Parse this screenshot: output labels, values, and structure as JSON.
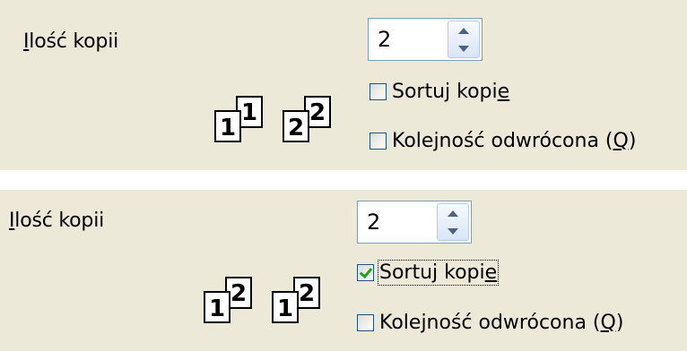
{
  "panel_unsorted": {
    "copies_label_prefix": "I",
    "copies_label_rest": "lość kopii",
    "copies_value": "2",
    "sort_label_main": "Sortuj kopi",
    "sort_label_accel": "e",
    "sort_checked": false,
    "reverse_label": "Kolejność odwrócona (",
    "reverse_accel": "Q",
    "reverse_close": ")",
    "reverse_checked": false,
    "icon": {
      "group1_back": "1",
      "group1_front": "1",
      "group2_back": "2",
      "group2_front": "2"
    }
  },
  "panel_sorted": {
    "copies_label_prefix": "I",
    "copies_label_rest": "lość kopii",
    "copies_value": "2",
    "sort_label_main": "Sortuj kopi",
    "sort_label_accel": "e",
    "sort_checked": true,
    "reverse_label": "Kolejność odwrócona (",
    "reverse_accel": "Q",
    "reverse_close": ")",
    "reverse_checked": false,
    "icon": {
      "group1_back": "2",
      "group1_front": "1",
      "group2_back": "2",
      "group2_front": "1"
    }
  },
  "colors": {
    "panel_bg": "#ece9d8",
    "field_border": "#7f9db9",
    "checkbox_border": "#1c5180",
    "check_mark": "#21a121"
  }
}
